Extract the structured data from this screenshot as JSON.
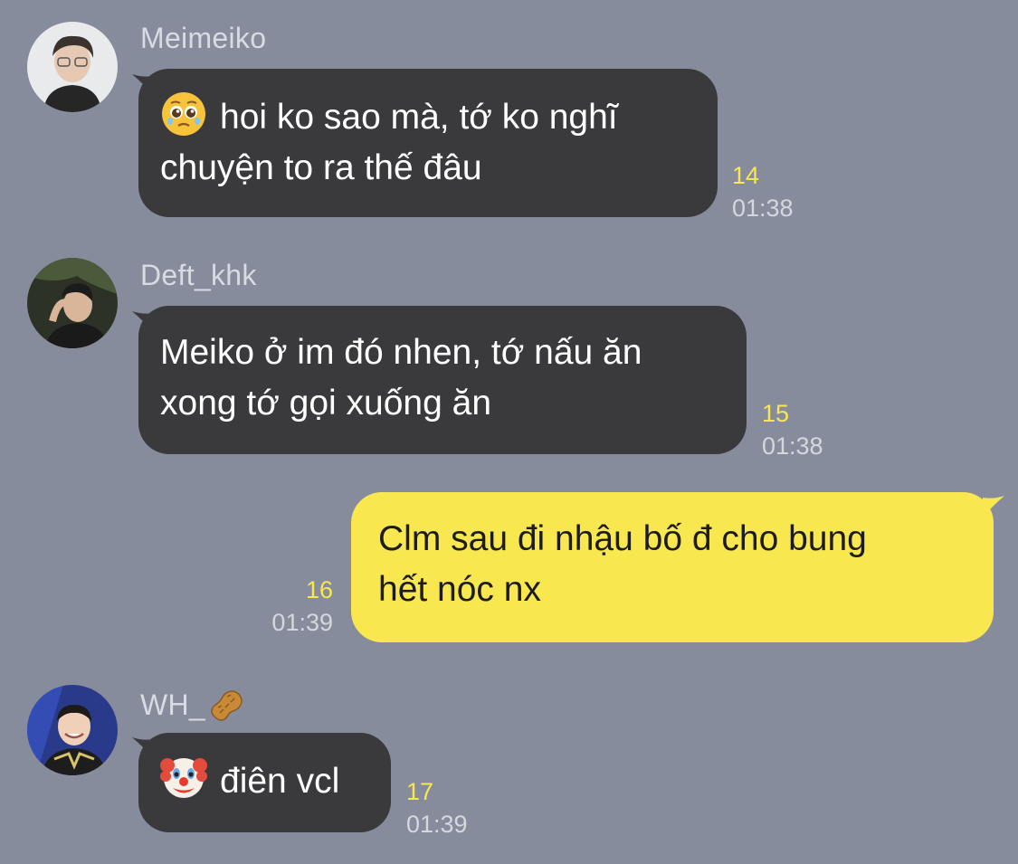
{
  "colors": {
    "background": "#868c9c",
    "incoming_bubble": "#3a3a3c",
    "outgoing_bubble": "#f8e74f",
    "read_count": "#f8e74f",
    "timestamp": "#d4d7de"
  },
  "messages": [
    {
      "sender": "Meimeiko",
      "emoji": "pleading-face-icon",
      "text_line1": "hoi ko sao mà, tớ ko nghĩ",
      "text_line2": "chuyện to ra thế đâu",
      "count": "14",
      "time": "01:38"
    },
    {
      "sender": "Deft_khk",
      "text_line1": "Meiko ở im đó nhen, tớ nấu ăn",
      "text_line2": "xong tớ gọi xuống ăn",
      "count": "15",
      "time": "01:38"
    },
    {
      "sender": "",
      "text_line1": "Clm sau đi nhậu bố đ cho bung",
      "text_line2": "hết nóc nx",
      "count": "16",
      "time": "01:39"
    },
    {
      "sender": "WH_",
      "sender_emoji": "peanut-icon",
      "emoji": "clown-face-icon",
      "text_line1": "điên vcl",
      "count": "17",
      "time": "01:39"
    }
  ]
}
